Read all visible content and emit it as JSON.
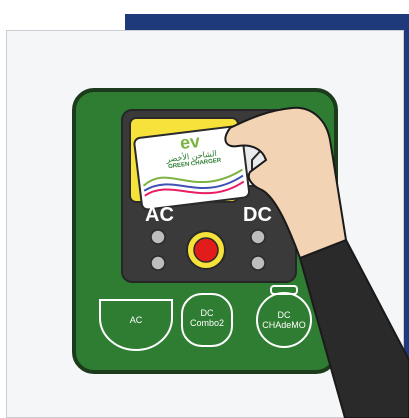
{
  "labels": {
    "ac": "AC",
    "dc": "DC"
  },
  "card": {
    "logo_text": "ev",
    "arabic_text": "الشاحن الأخضر",
    "brand_text": "GREEN CHARGER"
  },
  "ports": [
    {
      "line1": "AC",
      "line2": ""
    },
    {
      "line1": "DC",
      "line2": "Combo2"
    },
    {
      "line1": "DC",
      "line2": "CHAdeMO"
    }
  ],
  "colors": {
    "charger_body": "#2f7d32",
    "charger_border": "#1b3b1c",
    "screen_panel": "#3a3a3a",
    "reader_yellow": "#f6e23a",
    "accent_blue": "#1f3a7a",
    "stop_button": "#e21b1b",
    "sleeve": "#2a2a2a",
    "skin": "#f2d3b3"
  },
  "icons": [
    "rfid-card-icon",
    "home-screen-icon",
    "emergency-stop-button",
    "indicator-light"
  ]
}
